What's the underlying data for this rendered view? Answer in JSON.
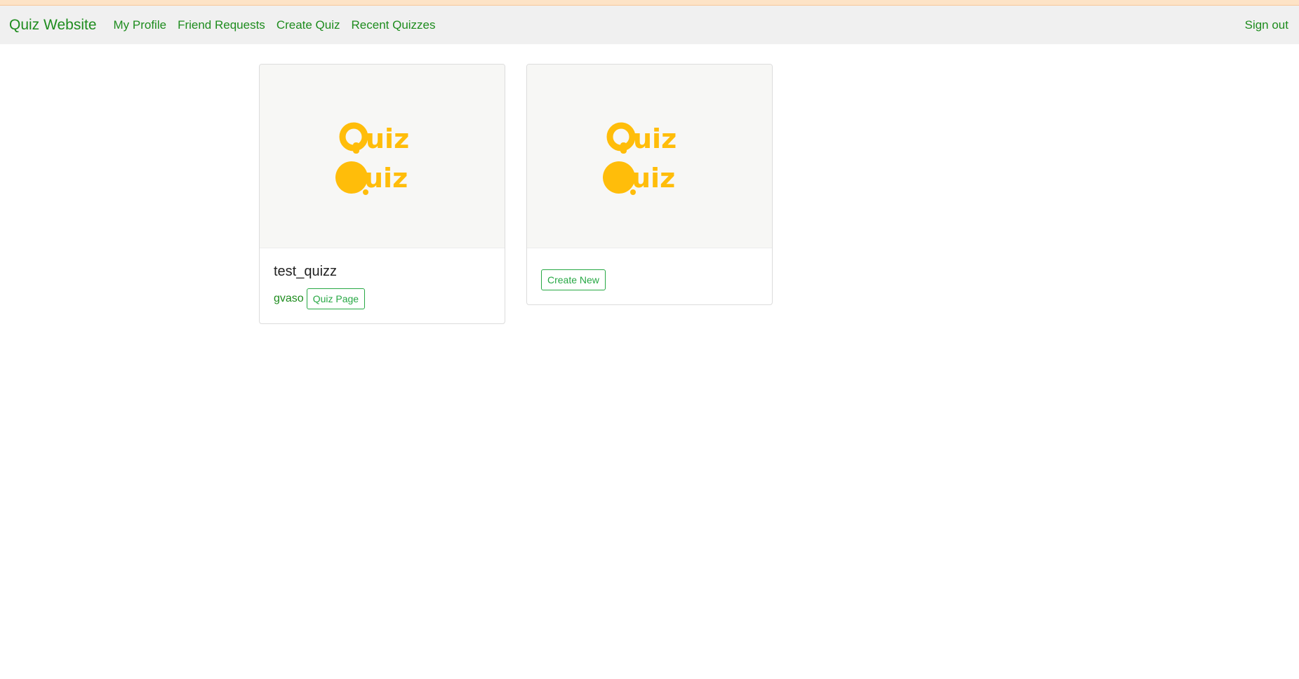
{
  "nav": {
    "brand": "Quiz Website",
    "links": [
      "My Profile",
      "Friend Requests",
      "Create Quiz",
      "Recent Quizzes"
    ],
    "signout": "Sign out"
  },
  "logo": {
    "word": "uiz",
    "color": "#ffbd0a"
  },
  "cards": [
    {
      "title": "test_quizz",
      "author": "gvaso",
      "button": "Quiz Page"
    },
    {
      "button": "Create New"
    }
  ]
}
